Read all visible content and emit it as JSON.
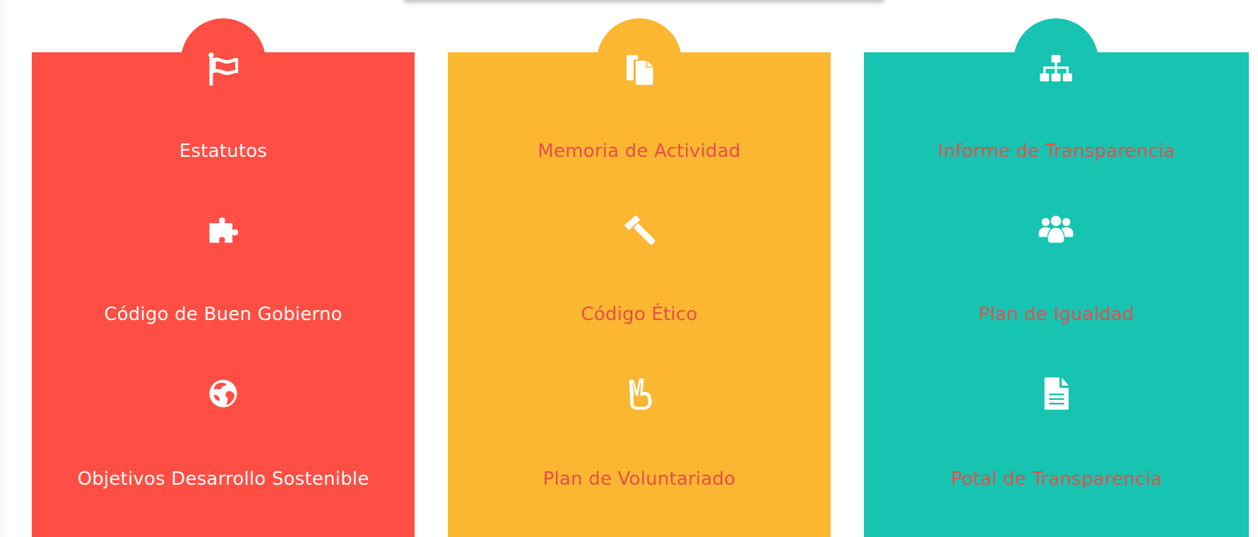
{
  "colors": {
    "red": "#ff4f44",
    "yellow": "#fbb632",
    "teal": "#17c3b1",
    "link_accent": "#e84e48",
    "icon": "#ffffff"
  },
  "cards": [
    {
      "top_icon": "flag-icon",
      "items": [
        {
          "label": "Estatutos"
        },
        {
          "icon": "puzzle-icon",
          "label": "Código de Buen Gobierno"
        },
        {
          "icon": "globe-icon",
          "label": "Objetivos Desarrollo Sostenible"
        }
      ]
    },
    {
      "top_icon": "documents-icon",
      "items": [
        {
          "label": "Memoria de Actividad"
        },
        {
          "icon": "gavel-icon",
          "label": "Código Ético"
        },
        {
          "icon": "peace-hand-icon",
          "label": "Plan de Voluntariado"
        }
      ]
    },
    {
      "top_icon": "org-chart-icon",
      "items": [
        {
          "label": "Informe de Transparencia"
        },
        {
          "icon": "users-icon",
          "label": "Plan de Igualdad"
        },
        {
          "icon": "file-text-icon",
          "label": "Potal de Transparencia"
        }
      ]
    }
  ]
}
